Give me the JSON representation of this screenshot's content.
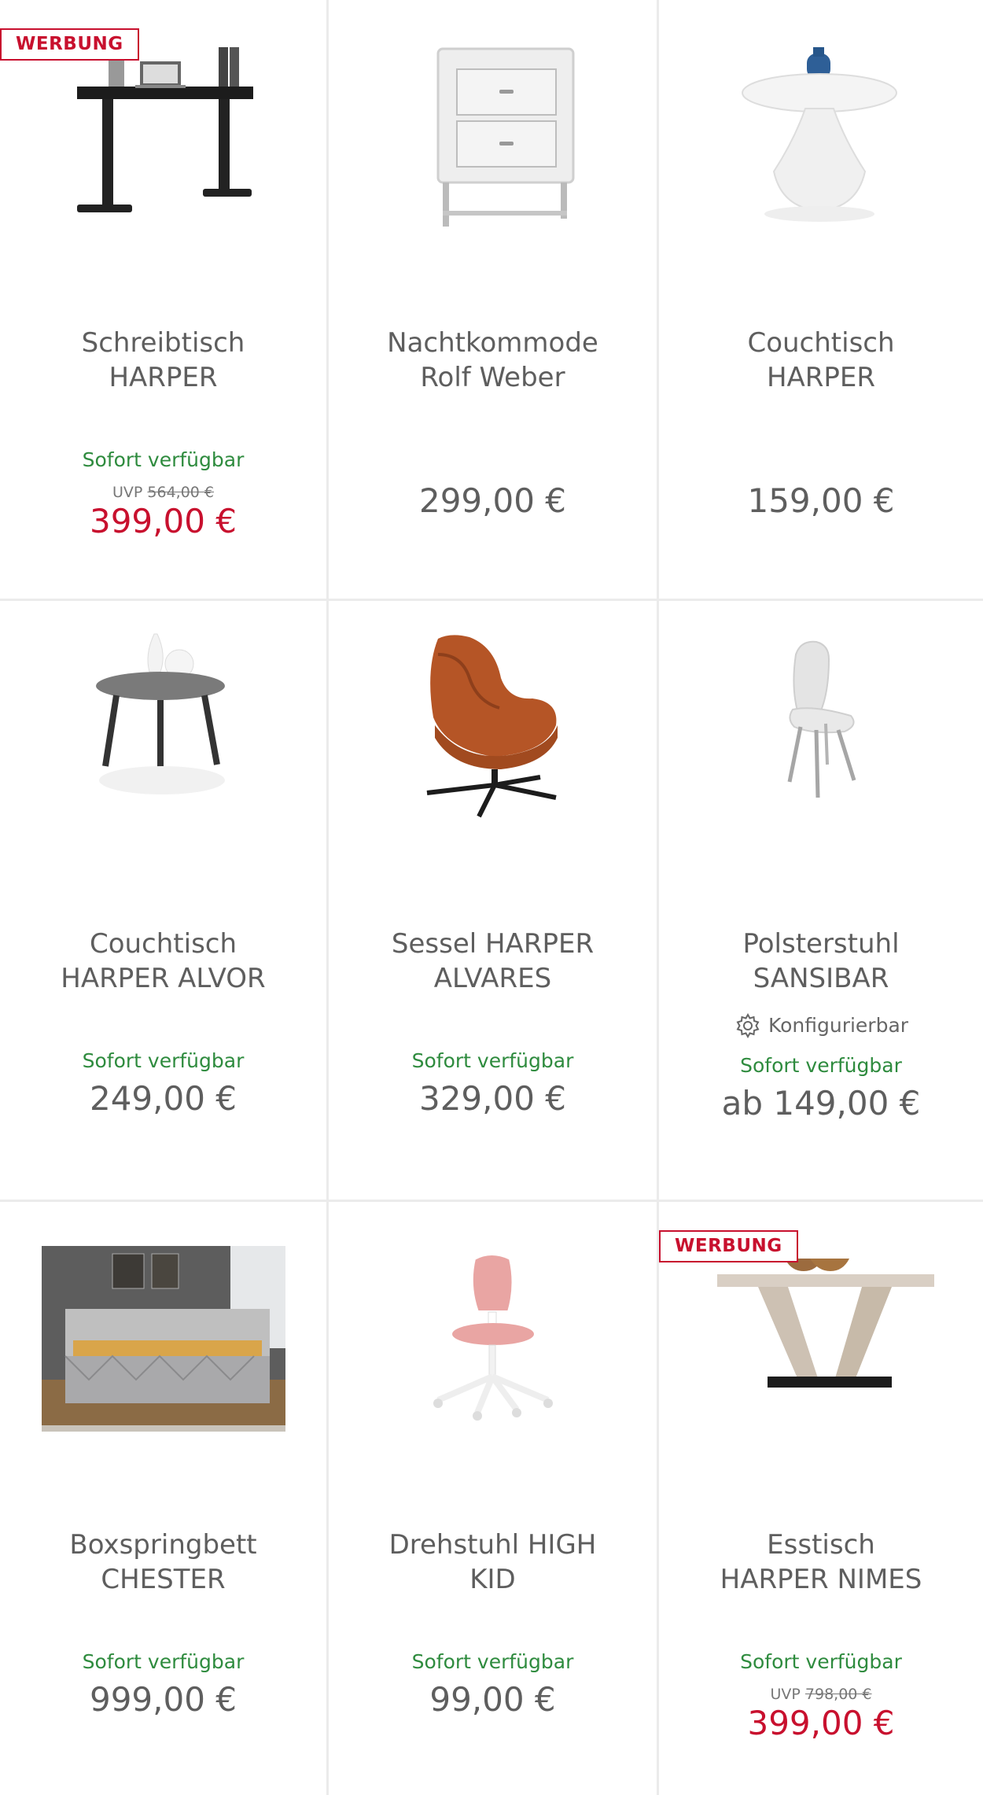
{
  "products": [
    {
      "id": "p1",
      "badge": "WERBUNG",
      "title": "Schreibtisch\nHARPER",
      "availability": "Sofort verfügbar",
      "uvp_label": "UVP",
      "uvp_value": "564,00 €",
      "price": "399,00 €",
      "sale": true,
      "image_icon": "desk-image"
    },
    {
      "id": "p2",
      "title": "Nachtkommode\nRolf Weber",
      "price": "299,00 €",
      "sale": false,
      "image_icon": "nightstand-image"
    },
    {
      "id": "p3",
      "title": "Couchtisch\nHARPER",
      "price": "159,00 €",
      "sale": false,
      "image_icon": "coffee-table-white-image"
    },
    {
      "id": "p4",
      "title": "Couchtisch\nHARPER ALVOR",
      "availability": "Sofort verfügbar",
      "price": "249,00 €",
      "sale": false,
      "image_icon": "coffee-table-grey-image"
    },
    {
      "id": "p5",
      "title": "Sessel HARPER\nALVARES",
      "availability": "Sofort verfügbar",
      "price": "329,00 €",
      "sale": false,
      "image_icon": "armchair-image"
    },
    {
      "id": "p6",
      "title": "Polsterstuhl\nSANSIBAR",
      "konfig": "Konfigurierbar",
      "availability": "Sofort verfügbar",
      "price": "ab 149,00 €",
      "sale": false,
      "image_icon": "upholstered-chair-image"
    },
    {
      "id": "p7",
      "title": "Boxspringbett\nCHESTER",
      "availability": "Sofort verfügbar",
      "price": "999,00 €",
      "sale": false,
      "image_icon": "boxspring-bed-image"
    },
    {
      "id": "p8",
      "title": "Drehstuhl HIGH\nKID",
      "availability": "Sofort verfügbar",
      "price": "99,00 €",
      "sale": false,
      "image_icon": "swivel-chair-image"
    },
    {
      "id": "p9",
      "badge": "WERBUNG",
      "title": "Esstisch\nHARPER NIMES",
      "availability": "Sofort verfügbar",
      "uvp_label": "UVP",
      "uvp_value": "798,00 €",
      "price": "399,00 €",
      "sale": true,
      "image_icon": "dining-table-image"
    }
  ],
  "colors": {
    "sale_red": "#c8102e",
    "available_green": "#2e8b3e",
    "text_grey": "#5e5e5e",
    "divider": "#ebebeb"
  }
}
